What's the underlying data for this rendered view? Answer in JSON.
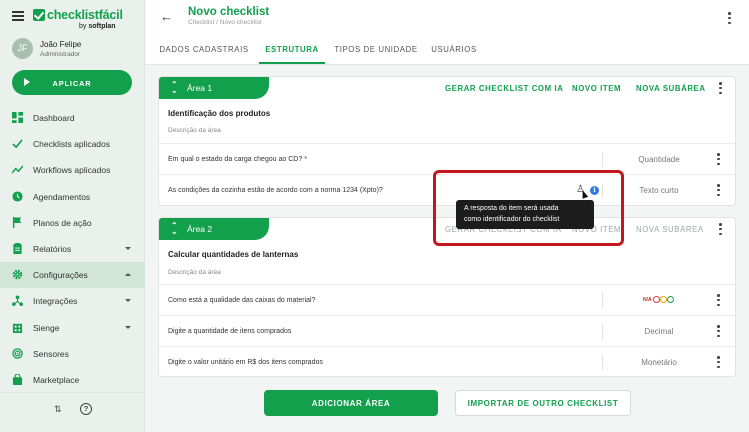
{
  "brand": {
    "name": "checklistfácil",
    "by": "by",
    "company": "softplan"
  },
  "user": {
    "initials": "JF",
    "name": "João Felipe",
    "role": "Administrador"
  },
  "apply_label": "APLICAR",
  "nav": [
    {
      "label": "Dashboard",
      "icon": "dashboard-icon"
    },
    {
      "label": "Checklists aplicados",
      "icon": "check-icon"
    },
    {
      "label": "Workflows aplicados",
      "icon": "trend-icon"
    },
    {
      "label": "Agendamentos",
      "icon": "clock-icon"
    },
    {
      "label": "Planos de ação",
      "icon": "flag-icon"
    },
    {
      "label": "Relatórios",
      "icon": "clipboard-icon",
      "caret": "down"
    },
    {
      "label": "Configurações",
      "icon": "gear-icon",
      "caret": "up",
      "active": true
    },
    {
      "label": "Integrações",
      "icon": "network-icon",
      "caret": "down"
    },
    {
      "label": "Sienge",
      "icon": "building-icon",
      "caret": "down"
    },
    {
      "label": "Sensores",
      "icon": "sensor-icon"
    },
    {
      "label": "Marketplace",
      "icon": "bag-icon"
    }
  ],
  "header": {
    "title": "Novo checklist",
    "breadcrumb": "Checklist / Novo checklist"
  },
  "tabs": [
    {
      "label": "DADOS CADASTRAIS"
    },
    {
      "label": "ESTRUTURA",
      "active": true
    },
    {
      "label": "TIPOS DE UNIDADE"
    },
    {
      "label": "USUÁRIOS"
    }
  ],
  "area_actions": {
    "generate": "GERAR CHECKLIST COM IA",
    "new_item": "NOVO ITEM",
    "new_subarea": "NOVA SUBÁREA"
  },
  "areas": [
    {
      "name": "Área 1",
      "title": "Identificação dos produtos",
      "description": "Descrição da área",
      "items": [
        {
          "question": "Em qual o estado da carga chegou ao CD? *",
          "type": "Quantidade"
        },
        {
          "question": "As condições da cozinha estão de acordo com a norma 1234 (Xpto)?",
          "type": "Texto curto"
        }
      ]
    },
    {
      "name": "Área 2",
      "title": "Calcular quantidades de lanternas",
      "description": "Descrição da área",
      "items": [
        {
          "question": "Como está a qualidade das caixas do material?",
          "type": "",
          "emoji_label": "N/A"
        },
        {
          "question": "Digite a quantidade de itens comprados",
          "type": "Decimal"
        },
        {
          "question": "Digite o valor unitário em R$ dos itens comprados",
          "type": "Monetário"
        }
      ]
    }
  ],
  "tooltip": {
    "line1": "A resposta do item será usada",
    "line2": "como identificador do checklist"
  },
  "buttons": {
    "add_area": "ADICIONAR ÁREA",
    "import": "IMPORTAR DE OUTRO CHECKLIST"
  },
  "colors": {
    "brand_green": "#12a04d",
    "highlight_red": "#c4161c",
    "info_blue": "#2b7de0"
  }
}
